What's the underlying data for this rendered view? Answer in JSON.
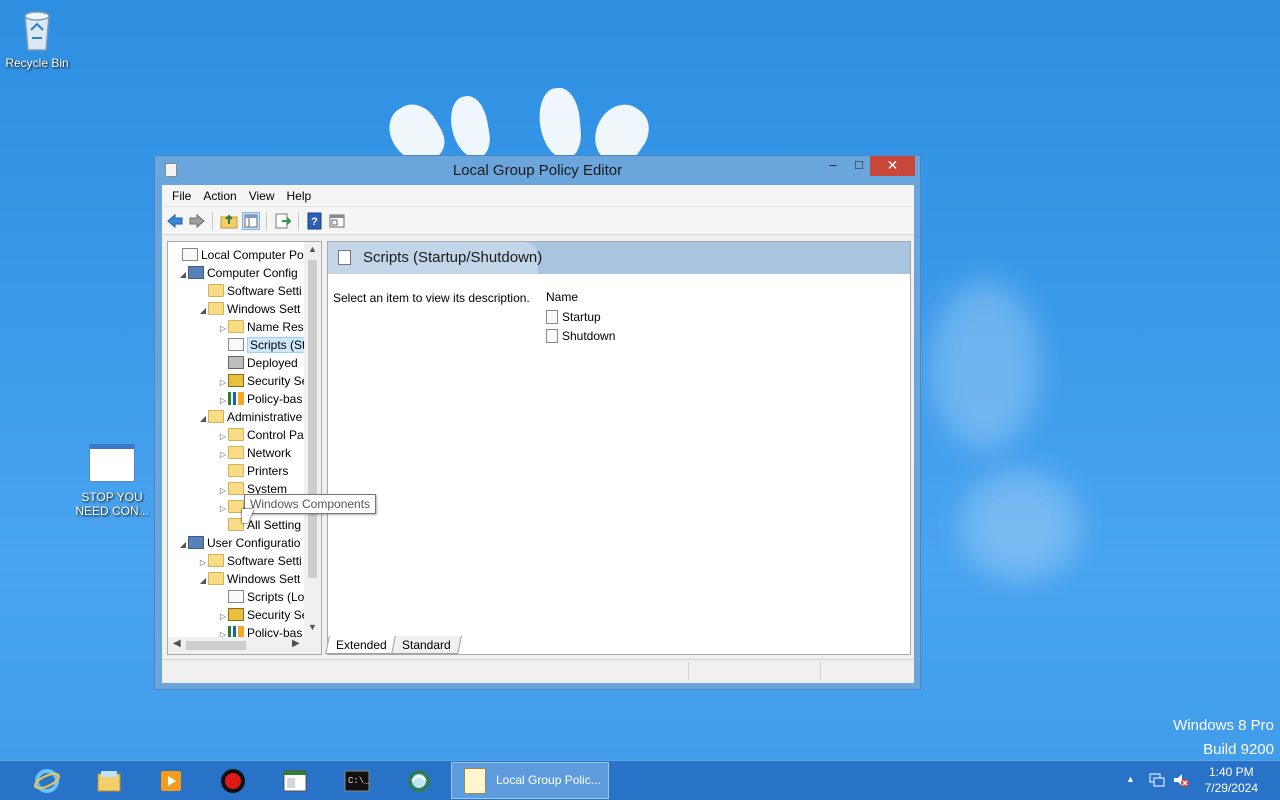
{
  "desktop": {
    "icons": [
      {
        "label": "Recycle Bin"
      },
      {
        "label_line1": "STOP YOU",
        "label_line2": "NEED CON..."
      }
    ],
    "watermark_line1": "Windows 8 Pro",
    "watermark_line2": "Build 9200"
  },
  "window": {
    "title": "Local Group Policy Editor",
    "controls": {
      "minimize": "–",
      "maximize": "□",
      "close": "✕"
    },
    "menu": [
      "File",
      "Action",
      "View",
      "Help"
    ],
    "toolbar_icons": [
      "back-icon",
      "forward-icon",
      "up-folder-icon",
      "show-hide-tree-icon",
      "export-list-icon",
      "help-icon",
      "properties-icon"
    ]
  },
  "tree": {
    "rows": [
      {
        "label": "Local Computer Polic",
        "arrow": ""
      },
      {
        "label": "Computer Config",
        "arrow": "◢"
      },
      {
        "label": "Software Setti",
        "arrow": ""
      },
      {
        "label": "Windows Sett",
        "arrow": "◢"
      },
      {
        "label": "Name Res",
        "arrow": "▷"
      },
      {
        "label": "Scripts (Sta",
        "arrow": ""
      },
      {
        "label": "Deployed",
        "arrow": ""
      },
      {
        "label": "Security Se",
        "arrow": "▷"
      },
      {
        "label": "Policy-bas",
        "arrow": "▷"
      },
      {
        "label": "Administrative",
        "arrow": "◢"
      },
      {
        "label": "Control Pa",
        "arrow": "▷"
      },
      {
        "label": "Network",
        "arrow": "▷"
      },
      {
        "label": "Printers",
        "arrow": ""
      },
      {
        "label": "System",
        "arrow": "▷"
      },
      {
        "label": "",
        "arrow": "▷"
      },
      {
        "label": "All Setting",
        "arrow": ""
      },
      {
        "label": "User Configuratio",
        "arrow": "◢"
      },
      {
        "label": "Software Setti",
        "arrow": "▷"
      },
      {
        "label": "Windows Sett",
        "arrow": "◢"
      },
      {
        "label": "Scripts (Lo",
        "arrow": ""
      },
      {
        "label": "Security Se",
        "arrow": "▷"
      },
      {
        "label": "Policy-bas",
        "arrow": "▷"
      }
    ]
  },
  "details": {
    "header": "Scripts (Startup/Shutdown)",
    "description": "Select an item to view its description.",
    "column_name": "Name",
    "items": [
      "Startup",
      "Shutdown"
    ],
    "tabs": [
      "Extended",
      "Standard"
    ]
  },
  "tooltip": "Windows Components",
  "taskbar": {
    "active_window": "Local Group Polic...",
    "apps": [
      "internet-explorer-icon",
      "file-explorer-icon",
      "media-player-icon",
      "record-icon",
      "window-app-icon",
      "command-prompt-icon",
      "globe-app-icon"
    ],
    "time": "1:40 PM",
    "date": "7/29/2024"
  },
  "colors": {
    "accent": "#2a88d8",
    "close_button": "#c7473a",
    "selection": "#cce8ff"
  }
}
